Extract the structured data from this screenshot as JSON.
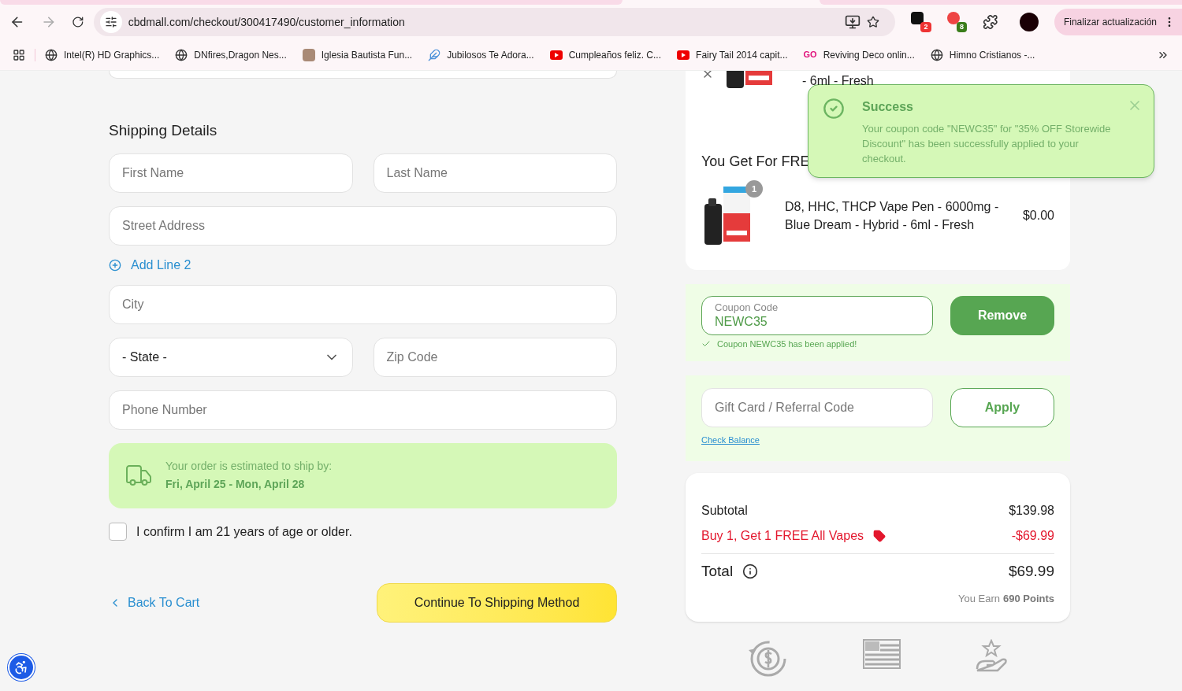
{
  "browser": {
    "url": "cbdmall.com/checkout/300417490/customer_information",
    "extension_badges": [
      "2",
      "8"
    ],
    "update_button": "Finalizar actualización",
    "bookmarks": [
      {
        "kind": "globe",
        "label": "Intel(R) HD Graphics..."
      },
      {
        "kind": "globe",
        "label": "DNfires,Dragon Nes..."
      },
      {
        "label": "Iglesia Bautista Fun..."
      },
      {
        "kind": "feather",
        "label": "Jubilosos Te Adora..."
      },
      {
        "kind": "youtube",
        "label": "Cumpleaños feliz. C..."
      },
      {
        "kind": "youtube",
        "label": "Fairy Tail 2014 capit..."
      },
      {
        "kind": "go",
        "label": "Reviving Deco onlin...",
        "icon_text": "GO"
      },
      {
        "kind": "globe",
        "label": "Himno Cristianos -..."
      }
    ]
  },
  "shipping": {
    "title": "Shipping Details",
    "rows": [
      [
        {
          "kind": "input",
          "placeholder": "First Name"
        },
        {
          "kind": "input",
          "placeholder": "Last Name"
        }
      ],
      [
        {
          "kind": "input",
          "placeholder": "Street Address"
        }
      ],
      [
        {
          "kind": "link",
          "label": "Add Line 2"
        }
      ],
      [
        {
          "kind": "input",
          "placeholder": "City"
        }
      ],
      [
        {
          "kind": "select",
          "value": "- State -"
        },
        {
          "kind": "input",
          "placeholder": "Zip Code"
        }
      ],
      [
        {
          "kind": "input",
          "placeholder": "Phone Number"
        }
      ]
    ],
    "estimate": {
      "label": "Your order is estimated to ship by:",
      "dates": "Fri, April 25 - Mon, April 28"
    },
    "age_confirm": {
      "label": "I confirm I am 21 years of age or older.",
      "checked": false
    },
    "back_link": "Back To Cart",
    "continue_button": "Continue To Shipping Method"
  },
  "order": {
    "top_item": {
      "name_fragment": "- 6ml - Fresh"
    },
    "free_title": "You Get For FRE",
    "free_item": {
      "quantity": "1",
      "name": "D8, HHC, THCP Vape Pen - 6000mg - Blue Dream - Hybrid - 6ml - Fresh",
      "price": "$0.00"
    },
    "coupon": {
      "label": "Coupon Code",
      "value": "NEWC35",
      "button": "Remove",
      "message": "Coupon NEWC35 has been applied!"
    },
    "gift": {
      "placeholder": "Gift Card / Referral Code",
      "button": "Apply",
      "link": "Check Balance"
    },
    "lines": [
      {
        "kind": "normal",
        "label": "Subtotal",
        "amount": "$139.98"
      },
      {
        "kind": "discount",
        "label": "Buy 1, Get 1 FREE All Vapes",
        "amount": "-$69.99"
      }
    ],
    "total": {
      "label": "Total",
      "amount": "$69.99"
    },
    "points": {
      "prefix": "You Earn",
      "value": "690 Points"
    }
  },
  "toast": {
    "title": "Success",
    "message": "Your coupon code \"NEWC35\" for \"35% OFF Storewide Discount\" has been successfully applied to your checkout."
  }
}
